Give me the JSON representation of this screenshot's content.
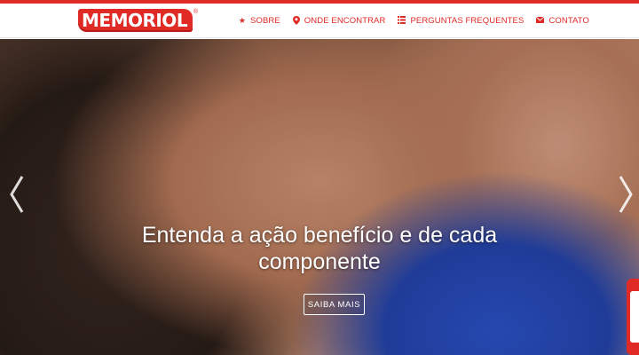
{
  "brand": {
    "name": "MEMORIOL",
    "reg": "®",
    "color": "#e02a26"
  },
  "nav": {
    "items": [
      {
        "label": "SOBRE",
        "icon": "star-icon"
      },
      {
        "label": "ONDE ENCONTRAR",
        "icon": "map-marker-icon"
      },
      {
        "label": "PERGUNTAS FREQUENTES",
        "icon": "list-icon"
      },
      {
        "label": "CONTATO",
        "icon": "envelope-icon"
      }
    ]
  },
  "hero": {
    "caption_line1": "Entenda a ação benefício e de cada",
    "caption_line2": "componente",
    "cta_label": "SAIBA MAIS"
  }
}
